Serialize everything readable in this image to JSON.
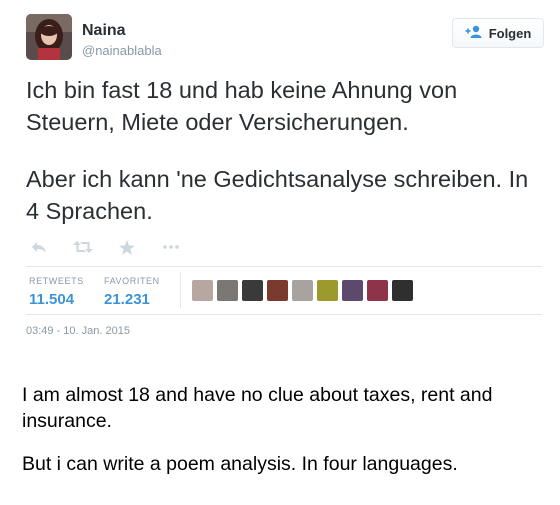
{
  "user": {
    "name": "Naina",
    "handle": "@nainablabla",
    "avatar_icon": "profile-avatar"
  },
  "follow_button": {
    "label": "Folgen",
    "icon": "add-user-icon"
  },
  "tweet": {
    "paragraphs": [
      "Ich bin fast 18 und hab keine Ahnung von Steuern, Miete oder Versicherungen.",
      "Aber ich kann 'ne Gedichtsanalyse schreiben. In 4 Sprachen."
    ]
  },
  "actions": [
    {
      "name": "reply-icon"
    },
    {
      "name": "retweet-icon"
    },
    {
      "name": "favorite-icon"
    },
    {
      "name": "more-icon"
    }
  ],
  "stats": {
    "retweets_label": "RETWEETS",
    "retweets_value": "11.504",
    "favorites_label": "FAVORITEN",
    "favorites_value": "21.231"
  },
  "favorited_by_avatars": [
    {
      "name": "favoriter-avatar-1",
      "color": "#b8a6a0"
    },
    {
      "name": "favoriter-avatar-2",
      "color": "#7b7773"
    },
    {
      "name": "favoriter-avatar-3",
      "color": "#3a3a3a"
    },
    {
      "name": "favoriter-avatar-4",
      "color": "#7a3b2e"
    },
    {
      "name": "favoriter-avatar-5",
      "color": "#a9a39f"
    },
    {
      "name": "favoriter-avatar-6",
      "color": "#9c9a2c"
    },
    {
      "name": "favoriter-avatar-7",
      "color": "#5c4a6e"
    },
    {
      "name": "favoriter-avatar-8",
      "color": "#8e3348"
    },
    {
      "name": "favoriter-avatar-9",
      "color": "#2f2f2f"
    }
  ],
  "timestamp": "03:49 - 10. Jan. 2015",
  "translation": {
    "paragraphs": [
      "I am almost 18 and have no clue about taxes, rent and insurance.",
      "But i can write a poem analysis. In four languages."
    ]
  },
  "colors": {
    "link_blue": "#3b94d9",
    "muted": "#8899a6",
    "text": "#292f33",
    "divider": "#e1e8ed"
  }
}
